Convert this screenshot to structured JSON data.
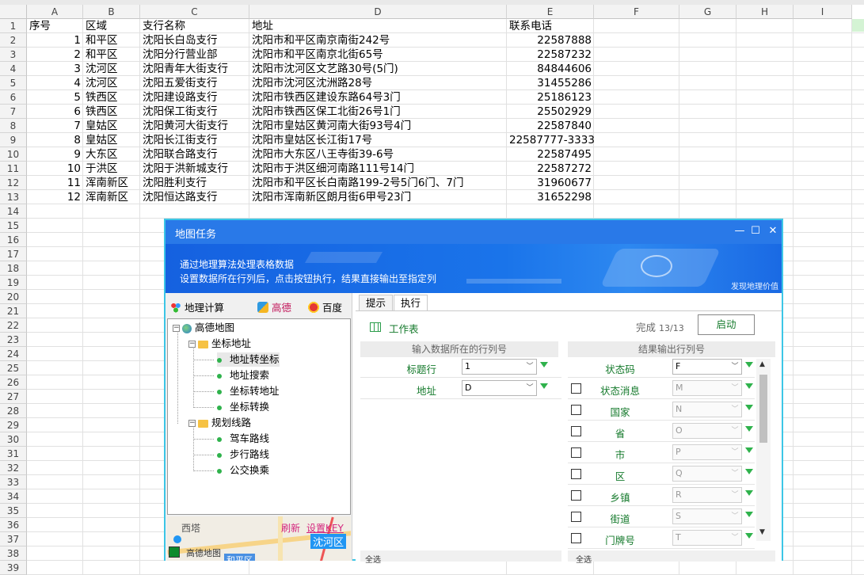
{
  "spreadsheet": {
    "columns": [
      "A",
      "B",
      "C",
      "D",
      "E",
      "F",
      "G",
      "H",
      "I"
    ],
    "rows": [
      "1",
      "2",
      "3",
      "4",
      "5",
      "6",
      "7",
      "8",
      "9",
      "10",
      "11",
      "12",
      "13",
      "14",
      "15",
      "16",
      "17",
      "18",
      "19",
      "20",
      "21",
      "22",
      "23",
      "24",
      "25",
      "26",
      "27",
      "28",
      "29",
      "30",
      "31",
      "32",
      "33",
      "34",
      "35",
      "36",
      "37",
      "38",
      "39"
    ],
    "headers": [
      "序号",
      "区域",
      "支行名称",
      "地址",
      "联系电话"
    ],
    "data": [
      [
        "1",
        "和平区",
        "沈阳长白岛支行",
        "沈阳市和平区南京南街242号",
        "22587888"
      ],
      [
        "2",
        "和平区",
        "沈阳分行营业部",
        "沈阳市和平区南京北街65号",
        "22587232"
      ],
      [
        "3",
        "沈河区",
        "沈阳青年大街支行",
        "沈阳市沈河区文艺路30号(5门)",
        "84844606"
      ],
      [
        "4",
        "沈河区",
        "沈阳五爱街支行",
        "沈阳市沈河区沈洲路28号",
        "31455286"
      ],
      [
        "5",
        "铁西区",
        "沈阳建设路支行",
        "沈阳市铁西区建设东路64号3门",
        "25186123"
      ],
      [
        "6",
        "铁西区",
        "沈阳保工街支行",
        "沈阳市铁西区保工北街26号1门",
        "25502929"
      ],
      [
        "7",
        "皇姑区",
        "沈阳黄河大街支行",
        "沈阳市皇姑区黄河南大街93号4门",
        "22587840"
      ],
      [
        "8",
        "皇姑区",
        "沈阳长江街支行",
        "沈阳市皇姑区长江街17号",
        "22587777-3333"
      ],
      [
        "9",
        "大东区",
        "沈阳联合路支行",
        "沈阳市大东区八王寺街39-6号",
        "22587495"
      ],
      [
        "10",
        "于洪区",
        "沈阳于洪新城支行",
        "沈阳市于洪区细河南路111号14门",
        "22587272"
      ],
      [
        "11",
        "浑南新区",
        "沈阳胜利支行",
        "沈阳市和平区长白南路199-2号5门6门、7门",
        "31960677"
      ],
      [
        "12",
        "浑南新区",
        "沈阳恒达路支行",
        "沈阳市浑南新区朗月街6甲号23门",
        "31652298"
      ]
    ]
  },
  "dialog": {
    "title": "地图任务",
    "banner_line1": "通过地理算法处理表格数据",
    "banner_line2": "设置数据所在行列后，点击按钮执行，结果直接输出至指定列",
    "banner_brand": "发现地理价值",
    "min_btn": "—",
    "max_btn": "☐",
    "close_btn": "✕",
    "left": {
      "tab_calc": "地理计算",
      "tab_gaode": "高德",
      "tab_baidu": "百度",
      "tree_root": "高德地图",
      "group1": "坐标地址",
      "group1_items": [
        "地址转坐标",
        "地址搜索",
        "坐标转地址",
        "坐标转换"
      ],
      "group2": "规划线路",
      "group2_items": [
        "驾车路线",
        "步行路线",
        "公交换乘"
      ],
      "map_west": "西塔",
      "map_refresh": "刷新",
      "map_key": "设置KEY",
      "map_district": "沈河区",
      "map_brand": "高德地图",
      "map_heping": "和平区"
    },
    "right": {
      "tab_hint": "提示",
      "tab_exec": "执行",
      "worksheet_label": "工作表",
      "done_label": "完成",
      "done_count": "13/13",
      "start_btn": "启动",
      "input_header": "输入数据所在的行列号",
      "output_header": "结果输出行列号",
      "inputs": [
        {
          "label": "标题行",
          "value": "1"
        },
        {
          "label": "地址",
          "value": "D"
        }
      ],
      "outputs": [
        {
          "label": "状态码",
          "value": "F",
          "checkbox": false,
          "enabled": true
        },
        {
          "label": "状态消息",
          "value": "M",
          "checkbox": true,
          "enabled": false
        },
        {
          "label": "国家",
          "value": "N",
          "checkbox": true,
          "enabled": false
        },
        {
          "label": "省",
          "value": "O",
          "checkbox": true,
          "enabled": false
        },
        {
          "label": "市",
          "value": "P",
          "checkbox": true,
          "enabled": false
        },
        {
          "label": "区",
          "value": "Q",
          "checkbox": true,
          "enabled": false
        },
        {
          "label": "乡镇",
          "value": "R",
          "checkbox": true,
          "enabled": false
        },
        {
          "label": "街道",
          "value": "S",
          "checkbox": true,
          "enabled": false
        },
        {
          "label": "门牌号",
          "value": "T",
          "checkbox": true,
          "enabled": false
        }
      ],
      "select_all_left": "全选",
      "select_all_right": "全选"
    }
  },
  "colors": {
    "titlebar": "#2979e8",
    "accent_green": "#2fb24c",
    "border_cyan": "#3cc6e6"
  }
}
